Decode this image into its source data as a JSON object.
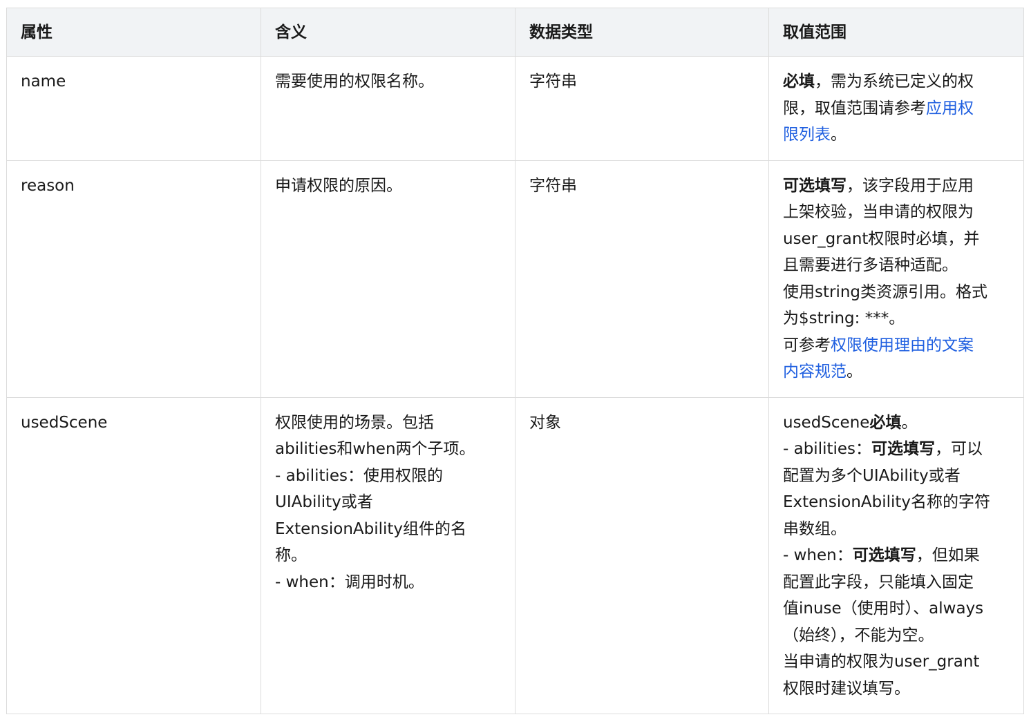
{
  "headers": {
    "attr": "属性",
    "meaning": "含义",
    "type": "数据类型",
    "range": "取值范围"
  },
  "rows": {
    "name": {
      "attr": "name",
      "meaning": "需要使用的权限名称。",
      "type": "字符串",
      "range": {
        "bold": "必填",
        "line1_rest": "，需为系统已定义的权",
        "line2_text": "限，取值范围请参考",
        "link_part1": "应用权",
        "link_part2": "限列表",
        "end": "。"
      }
    },
    "reason": {
      "attr": "reason",
      "meaning": "申请权限的原因。",
      "type": "字符串",
      "range": {
        "bold": "可选填写",
        "line1_rest": "，该字段用于应用",
        "line2": "上架校验，当申请的权限为",
        "line3": "user_grant权限时必填，并",
        "line4": "且需要进行多语种适配。",
        "line5": "使用string类资源引用。格式",
        "line6": "为$string: ***。",
        "line7_prefix": "可参考",
        "link_part1": "权限使用理由的文案",
        "link_part2": "内容规范",
        "end": "。"
      }
    },
    "used_scene": {
      "attr": "usedScene",
      "meaning": [
        "权限使用的场景。包括",
        "abilities和when两个子项。",
        "- abilities：使用权限的",
        "UIAbility或者",
        "ExtensionAbility组件的名",
        "称。",
        "- when：调用时机。"
      ],
      "type": "对象",
      "range": {
        "l1_prefix": "usedScene",
        "l1_bold": "必填",
        "l1_end": "。",
        "l2_prefix": "- abilities：",
        "l2_bold": "可选填写",
        "l2_rest": "，可以",
        "l3": "配置为多个UIAbility或者",
        "l4": "ExtensionAbility名称的字符",
        "l5": "串数组。",
        "l6_prefix": "- when：",
        "l6_bold": "可选填写",
        "l6_rest": "，但如果",
        "l7": "配置此字段，只能填入固定",
        "l8": "值inuse（使用时）、always",
        "l9": "（始终），不能为空。",
        "l10": "当申请的权限为user_grant",
        "l11": "权限时建议填写。"
      }
    }
  }
}
